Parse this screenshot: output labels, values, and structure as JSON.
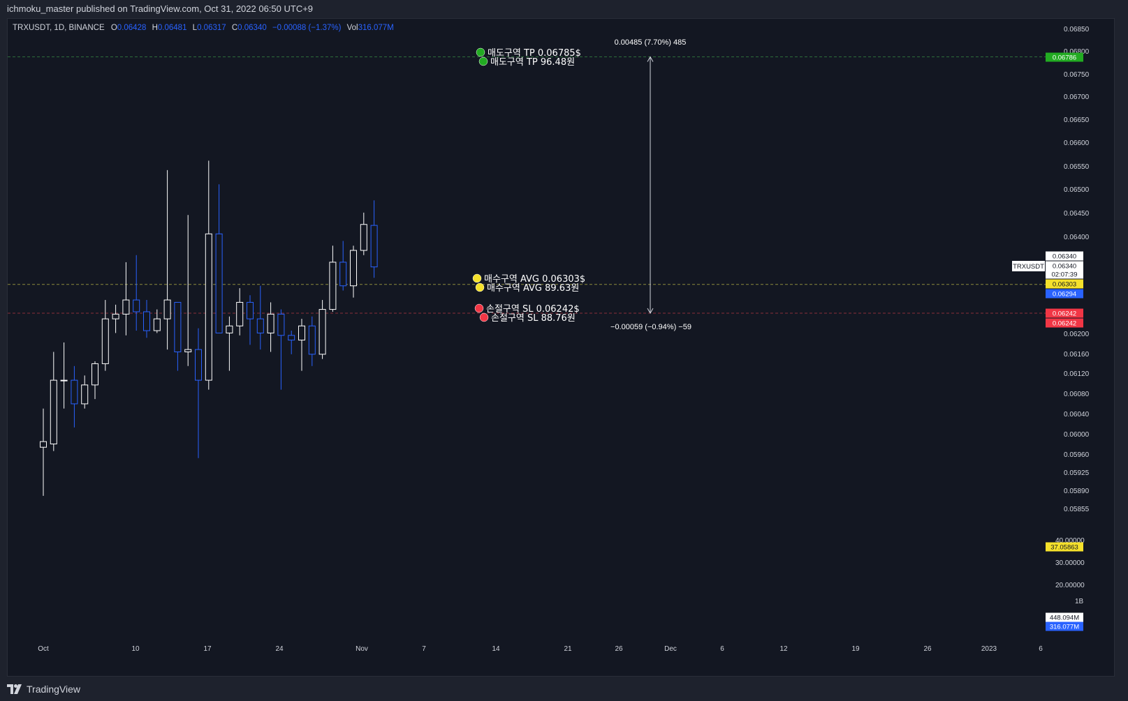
{
  "header": {
    "published": "ichmoku_master published on TradingView.com, Oct 31, 2022 06:50 UTC+9"
  },
  "legend": {
    "symbol": "TRXUSDT, 1D, BINANCE",
    "o_label": "O",
    "o_value": "0.06428",
    "h_label": "H",
    "h_value": "0.06481",
    "l_label": "L",
    "l_value": "0.06317",
    "c_label": "C",
    "c_value": "0.06340",
    "change": "−0.00088 (−1.37%)",
    "vol_label": "Vol",
    "vol_value": "316.077M"
  },
  "footer": {
    "brand": "TradingView"
  },
  "colors": {
    "background": "#131722",
    "frame": "#1e222d",
    "up_candle": "#ffffff",
    "down_candle": "#2962ff",
    "tp": "#22ab22",
    "avg": "#f5e12b",
    "sl": "#f23645",
    "text": "#d1d4dc"
  },
  "chart_data": {
    "type": "candlestick",
    "symbol": "TRXUSDT",
    "interval": "1D",
    "exchange": "BINANCE",
    "y_ticks": [
      "0.06850",
      "0.06800",
      "0.06750",
      "0.06700",
      "0.06650",
      "0.06600",
      "0.06550",
      "0.06500",
      "0.06450",
      "0.06400",
      "0.06200",
      "0.06160",
      "0.06120",
      "0.06080",
      "0.06040",
      "0.06000",
      "0.05960",
      "0.05925",
      "0.05890",
      "0.05855"
    ],
    "volume_ticks": [
      "40.00000",
      "30.00000",
      "20.00000",
      "1B"
    ],
    "x_ticks": [
      "Oct",
      "10",
      "17",
      "24",
      "Nov",
      "7",
      "14",
      "21",
      "26",
      "Dec",
      "6",
      "12",
      "19",
      "26",
      "2023",
      "6"
    ],
    "candles": [
      {
        "date": "2022-10-01",
        "open": 0.05958,
        "high": 0.0604,
        "low": 0.05855,
        "close": 0.0597
      },
      {
        "date": "2022-10-02",
        "open": 0.05965,
        "high": 0.0616,
        "low": 0.0595,
        "close": 0.061
      },
      {
        "date": "2022-10-03",
        "open": 0.061,
        "high": 0.0618,
        "low": 0.0604,
        "close": 0.061
      },
      {
        "date": "2022-10-04",
        "open": 0.061,
        "high": 0.0613,
        "low": 0.06,
        "close": 0.0605
      },
      {
        "date": "2022-10-05",
        "open": 0.0605,
        "high": 0.0611,
        "low": 0.0604,
        "close": 0.0609
      },
      {
        "date": "2022-10-06",
        "open": 0.0609,
        "high": 0.0614,
        "low": 0.0606,
        "close": 0.06135
      },
      {
        "date": "2022-10-07",
        "open": 0.06135,
        "high": 0.0627,
        "low": 0.0612,
        "close": 0.0623
      },
      {
        "date": "2022-10-08",
        "open": 0.0623,
        "high": 0.0626,
        "low": 0.062,
        "close": 0.0624
      },
      {
        "date": "2022-10-09",
        "open": 0.0624,
        "high": 0.0635,
        "low": 0.06195,
        "close": 0.0627
      },
      {
        "date": "2022-10-10",
        "open": 0.0627,
        "high": 0.06365,
        "low": 0.06205,
        "close": 0.06245
      },
      {
        "date": "2022-10-11",
        "open": 0.06245,
        "high": 0.0627,
        "low": 0.0619,
        "close": 0.06205
      },
      {
        "date": "2022-10-12",
        "open": 0.06205,
        "high": 0.0625,
        "low": 0.062,
        "close": 0.0623
      },
      {
        "date": "2022-10-13",
        "open": 0.0623,
        "high": 0.06545,
        "low": 0.06165,
        "close": 0.0627
      },
      {
        "date": "2022-10-14",
        "open": 0.06265,
        "high": 0.06255,
        "low": 0.0612,
        "close": 0.0616
      },
      {
        "date": "2022-10-15",
        "open": 0.0616,
        "high": 0.0645,
        "low": 0.0613,
        "close": 0.06165
      },
      {
        "date": "2022-10-16",
        "open": 0.06165,
        "high": 0.0621,
        "low": 0.05935,
        "close": 0.061
      },
      {
        "date": "2022-10-17",
        "open": 0.061,
        "high": 0.06565,
        "low": 0.0608,
        "close": 0.0641
      },
      {
        "date": "2022-10-18",
        "open": 0.0641,
        "high": 0.06515,
        "low": 0.062,
        "close": 0.062
      },
      {
        "date": "2022-10-19",
        "open": 0.062,
        "high": 0.06235,
        "low": 0.0612,
        "close": 0.06215
      },
      {
        "date": "2022-10-20",
        "open": 0.06215,
        "high": 0.06295,
        "low": 0.06195,
        "close": 0.06265
      },
      {
        "date": "2022-10-21",
        "open": 0.06265,
        "high": 0.0628,
        "low": 0.06175,
        "close": 0.0623
      },
      {
        "date": "2022-10-22",
        "open": 0.0623,
        "high": 0.063,
        "low": 0.06165,
        "close": 0.062
      },
      {
        "date": "2022-10-23",
        "open": 0.062,
        "high": 0.06265,
        "low": 0.0616,
        "close": 0.0624
      },
      {
        "date": "2022-10-24",
        "open": 0.0624,
        "high": 0.0625,
        "low": 0.0608,
        "close": 0.06195
      },
      {
        "date": "2022-10-25",
        "open": 0.06195,
        "high": 0.06205,
        "low": 0.06155,
        "close": 0.06185
      },
      {
        "date": "2022-10-26",
        "open": 0.06185,
        "high": 0.0623,
        "low": 0.0612,
        "close": 0.06215
      },
      {
        "date": "2022-10-27",
        "open": 0.06215,
        "high": 0.06235,
        "low": 0.0613,
        "close": 0.06155
      },
      {
        "date": "2022-10-28",
        "open": 0.06155,
        "high": 0.0627,
        "low": 0.06145,
        "close": 0.0625
      },
      {
        "date": "2022-10-29",
        "open": 0.0625,
        "high": 0.06385,
        "low": 0.06245,
        "close": 0.0635
      },
      {
        "date": "2022-10-30",
        "open": 0.0635,
        "high": 0.06395,
        "low": 0.0629,
        "close": 0.063
      },
      {
        "date": "2022-10-31",
        "open": 0.063,
        "high": 0.06385,
        "low": 0.06275,
        "close": 0.06375
      },
      {
        "date": "2022-11-01",
        "open": 0.06375,
        "high": 0.06455,
        "low": 0.06365,
        "close": 0.0643
      },
      {
        "date": "2022-11-02",
        "open": 0.06428,
        "high": 0.06481,
        "low": 0.06317,
        "close": 0.0634
      }
    ],
    "levels": [
      {
        "name": "tp",
        "value": 0.06785,
        "labels": [
          "매도구역 TP 0.06785$",
          "매도구역 TP 96.48원"
        ],
        "color": "#22ab22"
      },
      {
        "name": "avg",
        "value": 0.06303,
        "labels": [
          "매수구역 AVG 0.06303$",
          "매수구역 AVG 89.63원"
        ],
        "color": "#f5e12b"
      },
      {
        "name": "sl",
        "value": 0.06242,
        "labels": [
          "손절구역 SL 0.06242$",
          "손절구역 SL 88.76원"
        ],
        "color": "#f23645"
      }
    ],
    "measure": {
      "up_label": "0.00485 (7.70%) 485",
      "down_label": "−0.00059 (−0.94%) −59"
    },
    "price_tags": [
      {
        "name": "tp-level",
        "text": "0.06786",
        "bg": "#22ab22",
        "fg": "#ffffff"
      },
      {
        "name": "last-price",
        "text": "0.06340",
        "bg": "#ffffff",
        "fg": "#131722"
      },
      {
        "name": "last-price-2",
        "text": "0.06340",
        "bg": "#ffffff",
        "fg": "#131722"
      },
      {
        "name": "countdown",
        "text": "02:07:39",
        "bg": "#ffffff",
        "fg": "#131722"
      },
      {
        "name": "avg-level",
        "text": "0.06303",
        "bg": "#f5e12b",
        "fg": "#131722"
      },
      {
        "name": "blue-price",
        "text": "0.06294",
        "bg": "#2962ff",
        "fg": "#ffffff"
      },
      {
        "name": "sl-level",
        "text": "0.06242",
        "bg": "#f23645",
        "fg": "#ffffff"
      },
      {
        "name": "sl-level-2",
        "text": "0.06242",
        "bg": "#f23645",
        "fg": "#ffffff"
      },
      {
        "name": "vol-yellow",
        "text": "37.05863",
        "bg": "#f5e12b",
        "fg": "#131722"
      },
      {
        "name": "vol-white",
        "text": "448.094M",
        "bg": "#ffffff",
        "fg": "#131722"
      },
      {
        "name": "vol-blue",
        "text": "316.077M",
        "bg": "#2962ff",
        "fg": "#ffffff"
      }
    ],
    "symbol_tag": "TRXUSDT"
  }
}
